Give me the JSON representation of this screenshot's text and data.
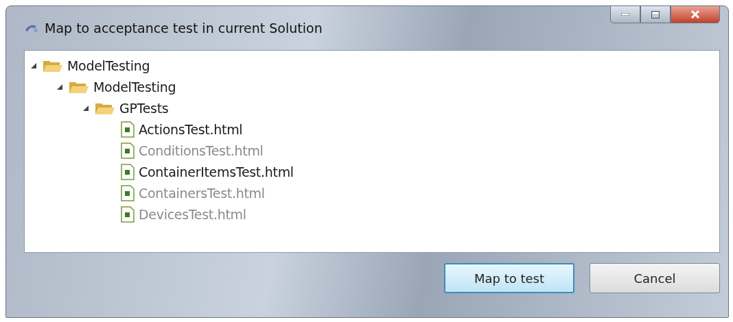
{
  "window": {
    "title": "Map to acceptance test in current Solution"
  },
  "tree": [
    {
      "kind": "folder",
      "label": "ModelTesting",
      "expanded": true,
      "children": [
        {
          "kind": "folder",
          "label": "ModelTesting",
          "expanded": true,
          "children": [
            {
              "kind": "folder",
              "label": "GPTests",
              "expanded": true,
              "children": [
                {
                  "kind": "file",
                  "label": "ActionsTest.html",
                  "disabled": false
                },
                {
                  "kind": "file",
                  "label": "ConditionsTest.html",
                  "disabled": true
                },
                {
                  "kind": "file",
                  "label": "ContainerItemsTest.html",
                  "disabled": false
                },
                {
                  "kind": "file",
                  "label": "ContainersTest.html",
                  "disabled": true
                },
                {
                  "kind": "file",
                  "label": "DevicesTest.html",
                  "disabled": true
                }
              ]
            }
          ]
        }
      ]
    }
  ],
  "buttons": [
    {
      "label": "Map to test",
      "default": true
    },
    {
      "label": "Cancel",
      "default": false
    }
  ]
}
